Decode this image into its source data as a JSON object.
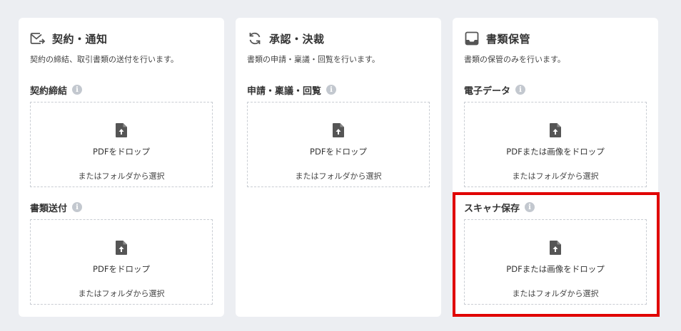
{
  "cards": [
    {
      "title": "契約・通知",
      "icon": "mail-send-icon",
      "description": "契約の締結、取引書類の送付を行います。",
      "sections": [
        {
          "label": "契約締結",
          "drop_text": "PDFをドロップ",
          "select_text": "またはフォルダから選択"
        },
        {
          "label": "書類送付",
          "drop_text": "PDFをドロップ",
          "select_text": "またはフォルダから選択"
        }
      ]
    },
    {
      "title": "承認・決裁",
      "icon": "refresh-icon",
      "description": "書類の申請・稟議・回覧を行います。",
      "sections": [
        {
          "label": "申請・稟議・回覧",
          "drop_text": "PDFをドロップ",
          "select_text": "またはフォルダから選択"
        }
      ]
    },
    {
      "title": "書類保管",
      "icon": "inbox-tray-icon",
      "description": "書類の保管のみを行います。",
      "sections": [
        {
          "label": "電子データ",
          "drop_text": "PDFまたは画像をドロップ",
          "select_text": "またはフォルダから選択"
        },
        {
          "label": "スキャナ保存",
          "drop_text": "PDFまたは画像をドロップ",
          "select_text": "またはフォルダから選択"
        }
      ]
    }
  ],
  "info_glyph": "i",
  "colors": {
    "background": "#eceef2",
    "card": "#ffffff",
    "dashed_border": "#c9cdd3",
    "info_icon": "#c3c8cf",
    "highlight": "#e00000"
  }
}
